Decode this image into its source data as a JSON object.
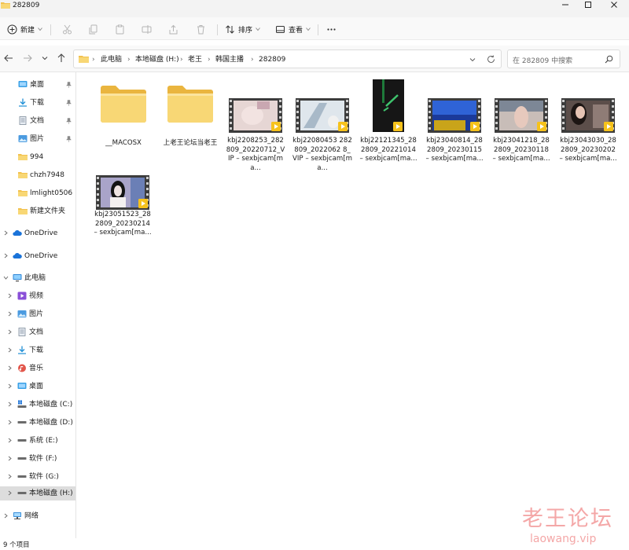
{
  "window": {
    "title": "282809"
  },
  "toolbar": {
    "new_label": "新建",
    "sort_label": "排序",
    "view_label": "查看",
    "icons": [
      "new-plus-icon",
      "cut-icon",
      "copy-icon",
      "paste-icon",
      "rename-icon",
      "share-icon",
      "delete-icon",
      "sort-icon",
      "view-icon",
      "more-icon"
    ]
  },
  "address": {
    "crumbs": [
      "此电脑",
      "本地磁盘 (H:)",
      "老王",
      "韩国主播",
      "282809"
    ],
    "search_placeholder": "在 282809 中搜索"
  },
  "navigation": {
    "quick_access": [
      {
        "label": "桌面",
        "icon": "desktop-icon",
        "pinned": true
      },
      {
        "label": "下载",
        "icon": "download-icon",
        "pinned": true
      },
      {
        "label": "文档",
        "icon": "document-icon",
        "pinned": true
      },
      {
        "label": "图片",
        "icon": "picture-icon",
        "pinned": true
      },
      {
        "label": "994",
        "icon": "folder-icon",
        "pinned": false
      },
      {
        "label": "chzh7948",
        "icon": "folder-icon",
        "pinned": false
      },
      {
        "label": "lmlight0506",
        "icon": "folder-icon",
        "pinned": false
      },
      {
        "label": "新建文件夹",
        "icon": "folder-icon",
        "pinned": false
      }
    ],
    "onedrive": [
      "OneDrive",
      "OneDrive"
    ],
    "this_pc": "此电脑",
    "pc_items": [
      {
        "label": "视频",
        "icon": "video-icon"
      },
      {
        "label": "图片",
        "icon": "picture-icon"
      },
      {
        "label": "文档",
        "icon": "document-icon"
      },
      {
        "label": "下载",
        "icon": "download-icon"
      },
      {
        "label": "音乐",
        "icon": "music-icon"
      },
      {
        "label": "桌面",
        "icon": "desktop-icon"
      },
      {
        "label": "本地磁盘 (C:)",
        "icon": "windows-drive-icon"
      },
      {
        "label": "本地磁盘 (D:)",
        "icon": "drive-icon"
      },
      {
        "label": "系统 (E:)",
        "icon": "drive-icon"
      },
      {
        "label": "软件 (F:)",
        "icon": "drive-icon"
      },
      {
        "label": "软件 (G:)",
        "icon": "drive-icon"
      },
      {
        "label": "本地磁盘 (H:)",
        "icon": "drive-icon",
        "selected": true
      }
    ],
    "network": "网络"
  },
  "files": [
    {
      "name": "__MACOSX",
      "type": "folder"
    },
    {
      "name": "上老王论坛当老王",
      "type": "folder"
    },
    {
      "name": "kbj2208253_282809_20220712_VIP – sexbjcam[ma...",
      "type": "video"
    },
    {
      "name": "kbj22080453 282809_2022062 8_VIP – sexbjcam[ma...",
      "type": "video"
    },
    {
      "name": "kbj22121345_282809_20221014 – sexbjcam[ma...",
      "type": "video"
    },
    {
      "name": "kbj23040814_282809_20230115 – sexbjcam[ma...",
      "type": "video"
    },
    {
      "name": "kbj23041218_282809_20230118 – sexbjcam[ma...",
      "type": "video"
    },
    {
      "name": "kbj23043030_282809_20230202 – sexbjcam[ma...",
      "type": "video"
    },
    {
      "name": "kbj23051523_282809_20230214 – sexbjcam[ma...",
      "type": "video"
    }
  ],
  "status": {
    "item_count": "9 个项目"
  },
  "watermark": {
    "text": "老王论坛",
    "url": "laowang.vip"
  },
  "colors": {
    "accent": "#0067c0",
    "folder": "#f8d775",
    "selected_bg": "#dddddd",
    "watermark": "#f4a7a7"
  }
}
